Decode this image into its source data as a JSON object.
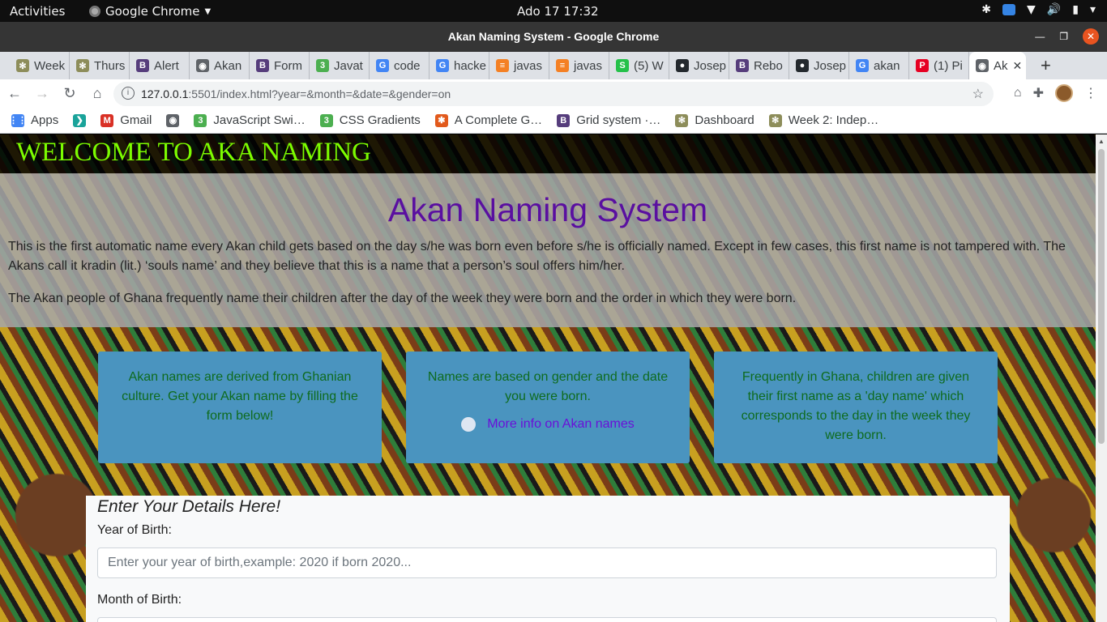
{
  "system": {
    "activities": "Activities",
    "app_name": "Google Chrome",
    "clock": "Ado 17  17:32"
  },
  "window": {
    "title": "Akan Naming System - Google Chrome"
  },
  "tabs": [
    {
      "label": "Week",
      "icon": "tree-icon",
      "color": "#8d8d5a"
    },
    {
      "label": "Thurs",
      "icon": "tree-icon",
      "color": "#8d8d5a"
    },
    {
      "label": "Alert",
      "icon": "bootstrap-icon",
      "color": "#563d7c"
    },
    {
      "label": "Akan",
      "icon": "globe-icon",
      "color": "#5f6368"
    },
    {
      "label": "Form",
      "icon": "bootstrap-icon",
      "color": "#563d7c"
    },
    {
      "label": "Javat",
      "icon": "w3-icon",
      "color": "#4caf50"
    },
    {
      "label": "code",
      "icon": "google-icon",
      "color": "#4285f4"
    },
    {
      "label": "hacke",
      "icon": "google-icon",
      "color": "#4285f4"
    },
    {
      "label": "javas",
      "icon": "stackoverflow-icon",
      "color": "#f48024"
    },
    {
      "label": "javas",
      "icon": "stackoverflow-icon",
      "color": "#f48024"
    },
    {
      "label": "(5) W",
      "icon": "slack-icon",
      "color": "#25c14a"
    },
    {
      "label": "Josep",
      "icon": "github-icon",
      "color": "#24292e"
    },
    {
      "label": "Rebo",
      "icon": "bootstrap-icon",
      "color": "#563d7c"
    },
    {
      "label": "Josep",
      "icon": "github-icon",
      "color": "#24292e"
    },
    {
      "label": "akan",
      "icon": "google-icon",
      "color": "#4285f4"
    },
    {
      "label": "(1) Pi",
      "icon": "pinterest-icon",
      "color": "#e60023"
    },
    {
      "label": "Ak",
      "icon": "globe-icon",
      "color": "#5f6368",
      "active": true
    }
  ],
  "address": {
    "url_host": "127.0.0.1",
    "url_rest": ":5501/index.html?year=&month=&date=&gender=on"
  },
  "bookmarks": [
    {
      "label": "Apps",
      "icon": "apps-grid-icon",
      "color": "#4285f4"
    },
    {
      "label": "",
      "icon": "chevron-logo-icon",
      "color": "#1aa39a"
    },
    {
      "label": "Gmail",
      "icon": "gmail-icon",
      "color": "#d93025"
    },
    {
      "label": "",
      "icon": "globe-icon",
      "color": "#5f6368"
    },
    {
      "label": "JavaScript Swi…",
      "icon": "w3-icon",
      "color": "#4caf50"
    },
    {
      "label": "CSS Gradients",
      "icon": "w3-icon",
      "color": "#4caf50"
    },
    {
      "label": "A Complete G…",
      "icon": "css-tricks-icon",
      "color": "#e25a1c"
    },
    {
      "label": "Grid system ·…",
      "icon": "bootstrap-icon",
      "color": "#563d7c"
    },
    {
      "label": "Dashboard",
      "icon": "tree-icon",
      "color": "#8d8d5a"
    },
    {
      "label": "Week 2: Indep…",
      "icon": "tree-icon",
      "color": "#8d8d5a"
    }
  ],
  "page": {
    "welcome": "WELCOME TO AKA NAMING",
    "heading": "Akan Naming System",
    "para1": "This is the first automatic name every Akan child gets based on the day s/he was born even before s/he is officially named. Except in few cases, this first name is not tampered with. The Akans call it kradin (lit.) ‘souls name’ and they believe that this is a name that a person’s soul offers him/her.",
    "para2": "The Akan people of Ghana frequently name their children after the day of the week they were born and the order in which they were born.",
    "cards": [
      {
        "text": "Akan names are derived from Ghanian culture. Get your Akan name by filling the form below!"
      },
      {
        "text": "Names are based on gender and the date you were born.",
        "link": "More info on Akan names"
      },
      {
        "text": "Frequently in Ghana, children are given their first name as a 'day name' which corresponds to the day in the week they were born."
      }
    ],
    "form": {
      "heading": "Enter Your Details Here!",
      "year_label": "Year of Birth:",
      "year_placeholder": "Enter your year of birth,example: 2020 if born 2020...",
      "month_label": "Month of Birth:"
    }
  }
}
